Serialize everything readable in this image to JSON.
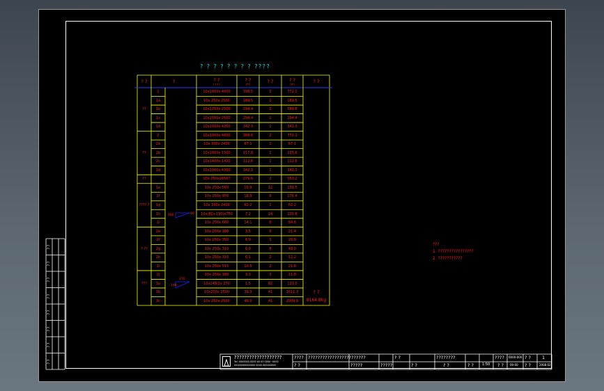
{
  "drawing_title": "? ? ? ? ? ? ? ?  ????",
  "table": {
    "headers": [
      "? ?",
      "?",
      "? ?",
      "? ?",
      "? ?",
      "? ?",
      "? ?"
    ],
    "header_sub": [
      "",
      "",
      "( x x )",
      "(m)",
      "",
      "(m)",
      ""
    ],
    "groups": [
      {
        "label": "??",
        "rows": 5
      },
      {
        "label": "??",
        "rows": 5
      },
      {
        "label": "??",
        "rows": 1
      },
      {
        "label": "???? ?",
        "rows": 5
      },
      {
        "label": "? ??",
        "rows": 5
      },
      {
        "label": "???",
        "rows": 3
      }
    ],
    "rows": [
      {
        "id": "1",
        "spec": "10x1000x 4000",
        "len": "398.5",
        "qty": "2",
        "total": "772.2"
      },
      {
        "id": "1a",
        "spec": "10x 250x 2500",
        "len": "189.5",
        "qty": "1",
        "total": "189.5"
      },
      {
        "id": "1b",
        "spec": "10x1250x 2500",
        "len": "294.4",
        "qty": "2",
        "total": "588.8"
      },
      {
        "id": "1c",
        "spec": "10x1500x 2500",
        "len": "294.4",
        "qty": "1",
        "total": "294.4"
      },
      {
        "id": "1d",
        "spec": "10x1000x 4360",
        "len": "342.3",
        "qty": "1",
        "total": "342.3"
      },
      {
        "id": "2",
        "spec": "10x1000x 4000",
        "len": "386.6",
        "qty": "2",
        "total": "772.2"
      },
      {
        "id": "2a",
        "spec": "10x 300x 2400",
        "len": "67.1",
        "qty": "1",
        "total": "67.1"
      },
      {
        "id": "2b",
        "spec": "10x1000x 1500",
        "len": "117.8",
        "qty": "2",
        "total": "235.6"
      },
      {
        "id": "2c",
        "spec": "10x1400x 1430",
        "len": "112.6",
        "qty": "1",
        "total": "112.6"
      },
      {
        "id": "2d",
        "spec": "10x1000x 4360",
        "len": "342.3",
        "qty": "1",
        "total": "342.3"
      },
      {
        "id": "",
        "spec": "10x 250x16567",
        "len": "276.6",
        "qty": "2",
        "total": "553.2"
      },
      {
        "id": "1e",
        "spec": "10x 250x 560",
        "len": "10.9",
        "qty": "12",
        "total": "130.5"
      },
      {
        "id": "1f",
        "spec": "10x 250x 950",
        "len": "18.9",
        "qty": "9",
        "total": "176.4"
      },
      {
        "id": "1g",
        "spec": "10x 330x 2400",
        "len": "62.2",
        "qty": "1",
        "total": "62.2"
      },
      {
        "id": "1h",
        "spec": "10x(80+190)x750",
        "len": "7.2",
        "qty": "14",
        "total": "100.8"
      },
      {
        "id": "1i",
        "spec": "10x 250x 660",
        "len": "14.1",
        "qty": "6",
        "total": "84.6"
      },
      {
        "id": "2e",
        "spec": "10x 250x 180",
        "len": "3.5",
        "qty": "6",
        "total": "21.4"
      },
      {
        "id": "2f",
        "spec": "10x 250x 350",
        "len": "6.9",
        "qty": "3",
        "total": "20.8"
      },
      {
        "id": "2g",
        "spec": "10x 250x 310",
        "len": "6.0",
        "qty": "8",
        "total": "48.0"
      },
      {
        "id": "2h",
        "spec": "10x 250x 310",
        "len": "6.1",
        "qty": "2",
        "total": "12.2"
      },
      {
        "id": "2i",
        "spec": "10x 250x 515",
        "len": "10.5",
        "qty": "2",
        "total": "21.8"
      },
      {
        "id": "2j",
        "spec": "10x 250x 180",
        "len": "3.3",
        "qty": "3",
        "total": "11.8"
      },
      {
        "id": "3a",
        "spec": "10x148/2x 270",
        "len": "1.5",
        "qty": "82",
        "total": "123.0"
      },
      {
        "id": "3b",
        "spec": "10x200x 2500",
        "len": "39.3",
        "qty": "41",
        "total": "1611.3"
      },
      {
        "id": "3c",
        "spec": "10x 250x 2500",
        "len": "49.0",
        "qty": "41",
        "total": "2009.6"
      }
    ],
    "grand_total": "8164.8",
    "grand_total_label": "? ?",
    "grand_total_unit": "kg",
    "diagram_labels": [
      "180",
      "80",
      "270",
      "148"
    ]
  },
  "notes": {
    "title": "???",
    "items": [
      "1. ????????????????",
      "2. ???????????"
    ]
  },
  "side_strip": [
    "? ?",
    "? ?",
    "? ?",
    "? ?",
    "? ?",
    "? ?",
    "? ?",
    "? ?"
  ],
  "title_block": {
    "project": "???????????????????",
    "project_sub_1": "Tel: 0000000-0000  00 00  0000~0000",
    "project_sub_2": "00000000000000  0000  000000000",
    "drawing_name": "????????????????????????",
    "label_1": "????",
    "label_2": "? ?",
    "label_3": "?????",
    "label_4": "?????",
    "label_5": "? ?",
    "label_6": "? ?",
    "label_7": "????????",
    "label_8": "? ?",
    "label_9": "? ?",
    "label_10": "????",
    "label_11": "? ?",
    "label_12": "? ?",
    "scale": "1:50",
    "code_1": "0000-000",
    "code_2": "00-00",
    "date": "2008.02",
    "sheet": "1"
  },
  "colors": {
    "table_line": "#ffff00",
    "table_text": "#ff2020",
    "title": "#00e5e5",
    "header_rule": "#2040ff",
    "frame": "#ffffff",
    "diagram": "#2020ff"
  }
}
